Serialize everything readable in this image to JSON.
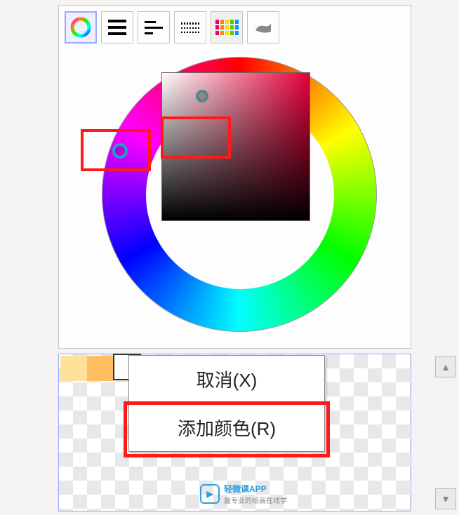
{
  "toolbar": {
    "mode_icons": [
      "color-wheel",
      "lines",
      "lines-varied",
      "dotted-lines",
      "color-grid",
      "brush"
    ]
  },
  "color_wheel": {
    "selected_hue_deg": 350,
    "sv_marker": {
      "s": 0.25,
      "v": 0.85
    }
  },
  "swatches": [
    {
      "color": "#ffe199"
    },
    {
      "color": "#ffc061"
    },
    {
      "color": "#ffffff",
      "selected": true
    }
  ],
  "context_menu": {
    "cancel": "取消(X)",
    "add_color": "添加颜色(R)"
  },
  "watermark": {
    "brand": "轻微课APP",
    "tagline": "最专业的绘画在线学"
  },
  "grid_icon_colors": [
    "#e06",
    "#f80",
    "#fd0",
    "#5c0",
    "#09f",
    "#e06",
    "#f80",
    "#fd0",
    "#5c0",
    "#09f",
    "#e06",
    "#f80",
    "#fd0",
    "#5c0",
    "#09f"
  ]
}
